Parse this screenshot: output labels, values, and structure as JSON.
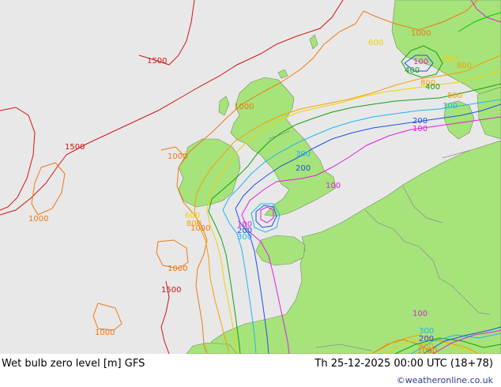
{
  "footer": {
    "title": "Wet bulb zero level [m] GFS",
    "valid_time": "Th 25-12-2025 00:00 UTC (18+78)",
    "credit": "©weatheronline.co.uk"
  },
  "colors": {
    "sea": "#e8e8e8",
    "land": "#a6e37a",
    "border": "#888888",
    "c100": "#e020e0",
    "c200": "#1e50e6",
    "c300": "#23b4f0",
    "c400": "#14a014",
    "c500": "#00c800",
    "c600": "#f0d200",
    "c800": "#f5a000",
    "c1000": "#f07814",
    "c1500": "#d21414"
  },
  "contour_labels": [
    {
      "id": "l1500a",
      "text": "1500",
      "level": "c1500"
    },
    {
      "id": "l1500b",
      "text": "1500",
      "level": "c1500"
    },
    {
      "id": "l1500c",
      "text": "1500",
      "level": "c1500"
    },
    {
      "id": "l1000a",
      "text": "1000",
      "level": "c1000"
    },
    {
      "id": "l1000b",
      "text": "1000",
      "level": "c1000"
    },
    {
      "id": "l1000c",
      "text": "1000",
      "level": "c1000"
    },
    {
      "id": "l1000d",
      "text": "1000",
      "level": "c1000"
    },
    {
      "id": "l1000e",
      "text": "1000",
      "level": "c1000"
    },
    {
      "id": "l1000f",
      "text": "1000",
      "level": "c1000"
    },
    {
      "id": "l1000g",
      "text": "1000",
      "level": "c1000"
    },
    {
      "id": "l1000h",
      "text": "1000",
      "level": "c1000"
    },
    {
      "id": "l800a",
      "text": "800",
      "level": "c800"
    },
    {
      "id": "l800b",
      "text": "800",
      "level": "c800"
    },
    {
      "id": "l800c",
      "text": "800",
      "level": "c800"
    },
    {
      "id": "l800d",
      "text": "800",
      "level": "c800"
    },
    {
      "id": "l800e",
      "text": "800",
      "level": "c800"
    },
    {
      "id": "l600a",
      "text": "600",
      "level": "c600"
    },
    {
      "id": "l600b",
      "text": "600",
      "level": "c600"
    },
    {
      "id": "l600c",
      "text": "600",
      "level": "c600"
    },
    {
      "id": "l400a",
      "text": "400",
      "level": "c400"
    },
    {
      "id": "l400b",
      "text": "400",
      "level": "c400"
    },
    {
      "id": "l300a",
      "text": "300",
      "level": "c300"
    },
    {
      "id": "l300b",
      "text": "300",
      "level": "c300"
    },
    {
      "id": "l300c",
      "text": "300",
      "level": "c300"
    },
    {
      "id": "l300d",
      "text": "300",
      "level": "c300"
    },
    {
      "id": "l200a",
      "text": "200",
      "level": "c200"
    },
    {
      "id": "l200b",
      "text": "200",
      "level": "c200"
    },
    {
      "id": "l200c",
      "text": "200",
      "level": "c200"
    },
    {
      "id": "l200d",
      "text": "200",
      "level": "c200"
    },
    {
      "id": "l100a",
      "text": "100",
      "level": "c100"
    },
    {
      "id": "l100b",
      "text": "100",
      "level": "c100"
    },
    {
      "id": "l100c",
      "text": "100",
      "level": "c100"
    },
    {
      "id": "l100d",
      "text": "100",
      "level": "c100"
    },
    {
      "id": "l100e",
      "text": "100",
      "level": "c100"
    }
  ]
}
